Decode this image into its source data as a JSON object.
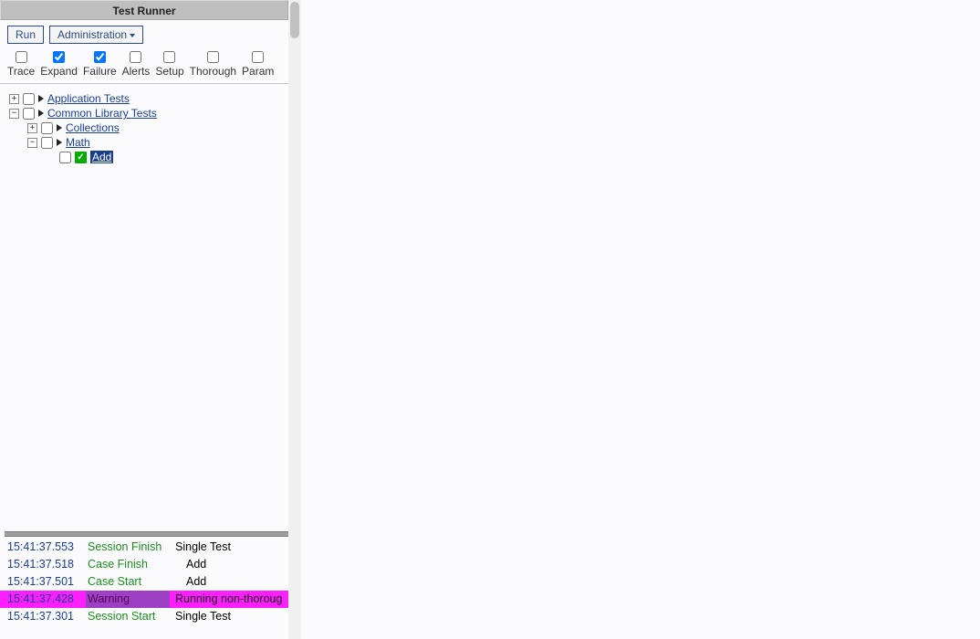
{
  "title": "Test Runner",
  "toolbar": {
    "run_label": "Run",
    "admin_label": "Administration"
  },
  "options": [
    {
      "label": "Trace",
      "checked": false
    },
    {
      "label": "Expand",
      "checked": true
    },
    {
      "label": "Failure",
      "checked": true
    },
    {
      "label": "Alerts",
      "checked": false
    },
    {
      "label": "Setup",
      "checked": false
    },
    {
      "label": "Thorough",
      "checked": false
    },
    {
      "label": "Param",
      "checked": false
    }
  ],
  "tree": {
    "app_tests": "Application Tests",
    "common_lib": "Common Library Tests",
    "collections": "Collections",
    "math": "Math",
    "add": "Add"
  },
  "log": [
    {
      "time": "15:41:37.553",
      "type": "Session Finish",
      "type_class": "green",
      "msg": "Single Test"
    },
    {
      "time": "15:41:37.518",
      "type": "Case Finish",
      "type_class": "green",
      "msg": "Add"
    },
    {
      "time": "15:41:37.501",
      "type": "Case Start",
      "type_class": "green",
      "msg": "Add"
    },
    {
      "time": "15:41:37.428",
      "type": "Warning",
      "type_class": "warn",
      "msg": "Running non-thoroug"
    },
    {
      "time": "15:41:37.301",
      "type": "Session Start",
      "type_class": "green",
      "msg": "Single Test"
    }
  ]
}
